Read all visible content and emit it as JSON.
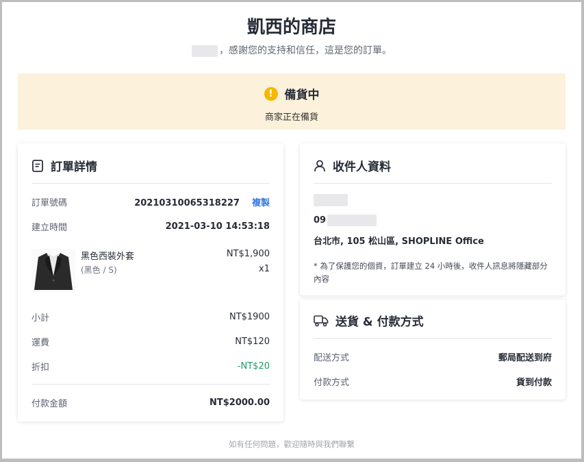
{
  "store": {
    "title": "凱西的商店",
    "thanks_text": "，感謝您的支持和信任，這是您的訂單。"
  },
  "status": {
    "icon": "exclamation-icon",
    "title": "備貨中",
    "description": "商家正在備貨",
    "color": "#f5b800"
  },
  "order": {
    "title": "訂單詳情",
    "number_label": "訂單號碼",
    "number": "20210310065318227",
    "copy_label": "複製",
    "created_label": "建立時間",
    "created": "2021-03-10 14:53:18",
    "product": {
      "name": "黑色西裝外套",
      "variant": "(黑色 / S)",
      "price": "NT$1,900",
      "qty": "x1"
    },
    "subtotal_label": "小計",
    "subtotal": "NT$1900",
    "shipping_label": "運費",
    "shipping": "NT$120",
    "discount_label": "折扣",
    "discount": "-NT$20",
    "total_label": "付款金額",
    "total": "NT$2000.00"
  },
  "recipient": {
    "title": "收件人資料",
    "phone_prefix": "09",
    "address": "台北市, 105 松山區, SHOPLINE Office",
    "note": "* 為了保護您的個資，訂單建立 24 小時後，收件人訊息將隱藏部分內容"
  },
  "delivery": {
    "title": "送貨 & 付款方式",
    "method_label": "配送方式",
    "method": "郵局配送到府",
    "payment_label": "付款方式",
    "payment": "貨到付款"
  },
  "footer": {
    "text": "如有任何問題，歡迎隨時與我們聯繫"
  },
  "colors": {
    "banner_bg": "#fcf1db",
    "link": "#3a7be0",
    "discount": "#1e9c63"
  }
}
